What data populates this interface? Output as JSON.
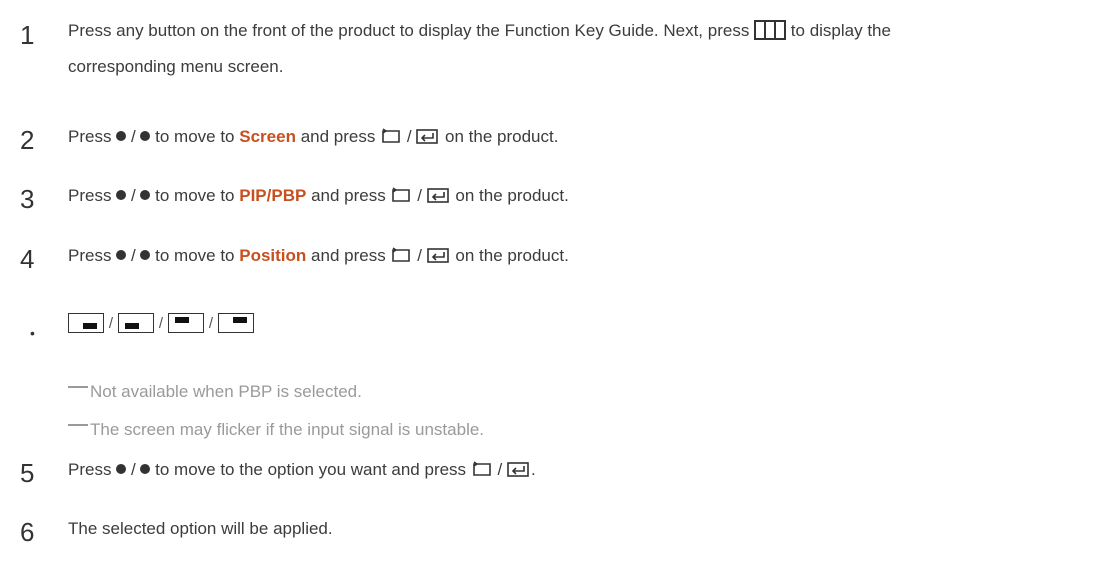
{
  "steps": [
    {
      "num": "1",
      "line1": "Press any button on the front of the product to display the Function Key Guide. Next, press",
      "line1_after": "to display the",
      "line2": "corresponding menu screen."
    },
    {
      "num": "2",
      "pre": "Press",
      "sep": "/",
      "mid": "to move to",
      "target": "Screen",
      "and_press": "and press",
      "post": "on the product."
    },
    {
      "num": "3",
      "pre": "Press",
      "sep": "/",
      "mid": "to move to",
      "target": "PIP/PBP",
      "and_press": "and press",
      "post": "on the product."
    },
    {
      "num": "4",
      "pre": "Press",
      "sep": "/",
      "mid": "to move to",
      "target": "Position",
      "and_press": "and press",
      "post": "on the product."
    },
    {
      "num": "5",
      "pre": "Press",
      "sep": "/",
      "mid": "to move to the option you want and press",
      "end": "."
    },
    {
      "num": "6",
      "text": "The selected option will be applied."
    }
  ],
  "bullet": "•",
  "position_sep": "/",
  "position_options": [
    {
      "icon": "pip-bottom-right-icon"
    },
    {
      "icon": "pip-bottom-left-icon"
    },
    {
      "icon": "pip-top-left-icon"
    },
    {
      "icon": "pip-top-right-icon"
    }
  ],
  "notes": [
    "Not available when PBP is selected.",
    "The screen may flicker if the input signal is unstable."
  ],
  "colors": {
    "highlight": "#c8501e",
    "text": "#3c3c3c",
    "note": "#9a9a9a"
  },
  "icons": {
    "menu": "menu-grid-icon",
    "nav": "dot-button-icon",
    "select": "return-icon",
    "enter": "enter-icon"
  }
}
